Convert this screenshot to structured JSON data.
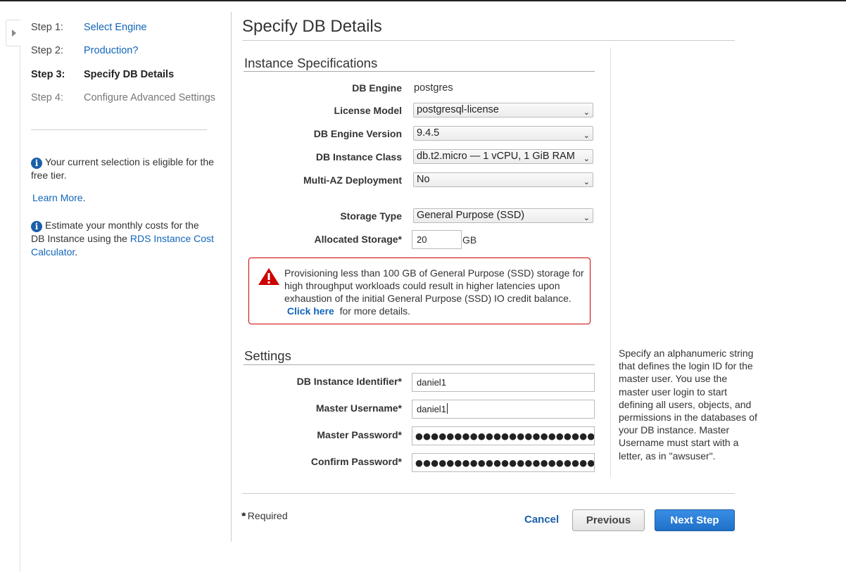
{
  "sidebar": {
    "steps": [
      {
        "num": "Step 1:",
        "label": "Select Engine",
        "state": "link"
      },
      {
        "num": "Step 2:",
        "label": "Production?",
        "state": "link"
      },
      {
        "num": "Step 3:",
        "label": "Specify DB Details",
        "state": "active"
      },
      {
        "num": "Step 4:",
        "label": "Configure Advanced Settings",
        "state": "disabled"
      }
    ],
    "free_tier_text": "Your current selection is eligible for the free tier.",
    "learn_more": "Learn More",
    "learn_more_suffix": ".",
    "estimate_text": "Estimate your monthly costs for the DB Instance using the",
    "calculator_link": "RDS Instance Cost Calculator",
    "calculator_suffix": "."
  },
  "page_title": "Specify DB Details",
  "instance_specs": {
    "title": "Instance Specifications",
    "db_engine_label": "DB Engine",
    "db_engine_value": "postgres",
    "license_model_label": "License Model",
    "license_model_value": "postgresql-license",
    "engine_version_label": "DB Engine Version",
    "engine_version_value": "9.4.5",
    "instance_class_label": "DB Instance Class",
    "instance_class_value": "db.t2.micro — 1 vCPU, 1 GiB RAM",
    "multi_az_label": "Multi-AZ Deployment",
    "multi_az_value": "No",
    "storage_type_label": "Storage Type",
    "storage_type_value": "General Purpose (SSD)",
    "allocated_storage_label": "Allocated Storage*",
    "allocated_storage_value": "20",
    "allocated_storage_unit": "GB"
  },
  "warning": {
    "text": "Provisioning less than 100 GB of General Purpose (SSD) storage for high throughput workloads could result in higher latencies upon exhaustion of the initial General Purpose (SSD) IO credit balance.",
    "link": "Click here",
    "suffix": "for more details."
  },
  "settings": {
    "title": "Settings",
    "identifier_label": "DB Instance Identifier*",
    "identifier_value": "daniel1",
    "username_label": "Master Username*",
    "username_value": "daniel1",
    "password_label": "Master Password*",
    "password_value": "●●●●●●●●●●●●●●●●●●●●●●●●●●●",
    "confirm_label": "Confirm Password*",
    "confirm_value": "●●●●●●●●●●●●●●●●●●●●●●●●●●●"
  },
  "help_text": "Specify an alphanumeric string that defines the login ID for the master user. You use the master user login to start defining all users, objects, and permissions in the databases of your DB instance. Master Username must start with a letter, as in \"awsuser\".",
  "footer": {
    "required_note": "* Required",
    "cancel": "Cancel",
    "previous": "Previous",
    "next": "Next Step"
  },
  "icons": {
    "expand": "chevron-right-icon",
    "info": "info-icon",
    "warning": "warning-triangle-icon",
    "dropdown": "chevron-down-icon"
  },
  "colors": {
    "link": "#1166bb",
    "primary_button": "#1f6fc6",
    "warning_border": "#cc0000"
  }
}
